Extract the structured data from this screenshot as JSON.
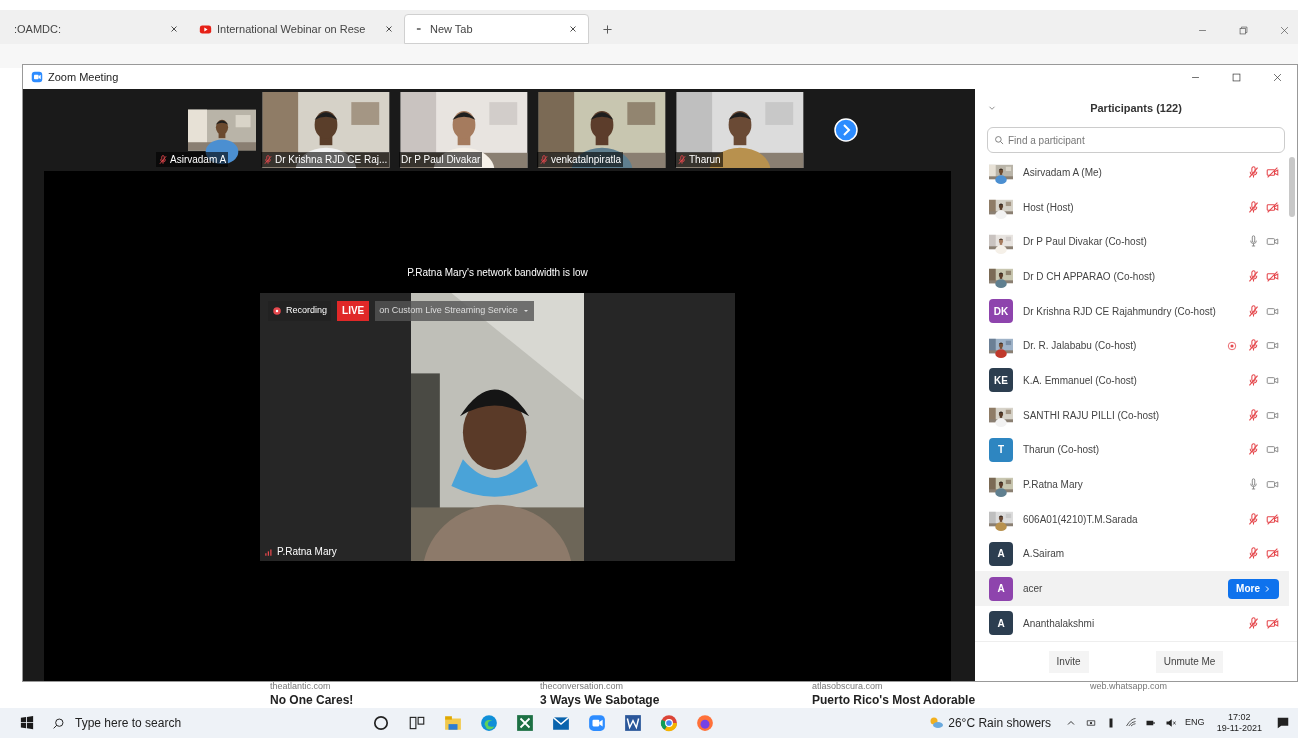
{
  "browser": {
    "tabs": [
      {
        "title": ":OAMDC:",
        "kind": "plain",
        "selected": false
      },
      {
        "title": "International Webinar on Rese",
        "kind": "video",
        "selected": false
      },
      {
        "title": "New Tab",
        "kind": "newtab",
        "selected": true
      }
    ],
    "news": [
      {
        "site": "theatlantic.com",
        "title": "No One Cares!"
      },
      {
        "site": "theconversation.com",
        "title": "3 Ways We Sabotage"
      },
      {
        "site": "atlasobscura.com",
        "title": "Puerto Rico's Most Adorable"
      },
      {
        "site": "web.whatsapp.com"
      }
    ]
  },
  "zoom": {
    "title": "Zoom Meeting",
    "thumbnails": [
      {
        "name": "Asirvadam A",
        "muted": true
      },
      {
        "name": "Dr Krishna RJD CE Raj...",
        "muted": true
      },
      {
        "name": "Dr P Paul Divakar",
        "muted": false
      },
      {
        "name": "venkatalnpiratla",
        "muted": true
      },
      {
        "name": "Tharun",
        "muted": true
      }
    ],
    "notice": "P.Ratna Mary's network bandwidth is low",
    "main_video": {
      "name": "P.Ratna Mary",
      "recording_label": "Recording",
      "live_label": "LIVE",
      "stream_label": "on Custom Live Streaming Service"
    },
    "participants": {
      "title": "Participants (122)",
      "search_placeholder": "Find a participant",
      "items": [
        {
          "name": "Asirvadam A (Me)",
          "muted": true,
          "video_on": false,
          "recording": false,
          "selected": false
        },
        {
          "name": "Host (Host)",
          "muted": true,
          "video_on": false,
          "recording": false,
          "selected": false
        },
        {
          "name": "Dr P Paul Divakar (Co-host)",
          "muted": false,
          "video_on": true,
          "recording": false,
          "selected": false
        },
        {
          "name": "Dr D CH APPARAO (Co-host)",
          "muted": true,
          "video_on": false,
          "recording": false,
          "selected": false
        },
        {
          "name": "Dr Krishna RJD CE Rajahmundry (Co-host)",
          "avatar": {
            "kind": "initials",
            "text": "DK",
            "color": "#8e44ad"
          },
          "muted": true,
          "video_on": true,
          "recording": false,
          "selected": false
        },
        {
          "name": "Dr. R. Jalababu (Co-host)",
          "muted": true,
          "video_on": true,
          "recording": true,
          "selected": false
        },
        {
          "name": "K.A. Emmanuel (Co-host)",
          "avatar": {
            "kind": "initials",
            "text": "KE",
            "color": "#2c3e50"
          },
          "muted": true,
          "video_on": true,
          "recording": false,
          "selected": false
        },
        {
          "name": "SANTHI RAJU PILLI (Co-host)",
          "muted": true,
          "video_on": true,
          "recording": false,
          "selected": false
        },
        {
          "name": "Tharun (Co-host)",
          "avatar": {
            "kind": "initials",
            "text": "T",
            "color": "#2e86c1"
          },
          "muted": true,
          "video_on": true,
          "recording": false,
          "selected": false
        },
        {
          "name": "P.Ratna Mary",
          "muted": false,
          "video_on": true,
          "recording": false,
          "selected": false
        },
        {
          "name": "606A01(4210)T.M.Sarada",
          "muted": true,
          "video_on": false,
          "recording": false,
          "selected": false
        },
        {
          "name": "A.Sairam",
          "avatar": {
            "kind": "initials",
            "text": "A",
            "color": "#2c3e50"
          },
          "muted": true,
          "video_on": false,
          "recording": false,
          "selected": false
        },
        {
          "name": "acer",
          "avatar": {
            "kind": "initials",
            "text": "A",
            "color": "#8e44ad"
          },
          "recording": false,
          "selected": true,
          "action": "More"
        },
        {
          "name": "Ananthalakshmi",
          "avatar": {
            "kind": "initials",
            "text": "A",
            "color": "#2c3e50"
          },
          "muted": true,
          "video_on": false,
          "recording": false,
          "selected": false
        }
      ],
      "buttons": [
        "Invite",
        "Unmute Me"
      ]
    }
  },
  "taskbar": {
    "search_placeholder": "Type here to search",
    "weather": "26°C Rain showers",
    "language": "ENG",
    "time": "17:02",
    "date": "19-11-2021"
  }
}
